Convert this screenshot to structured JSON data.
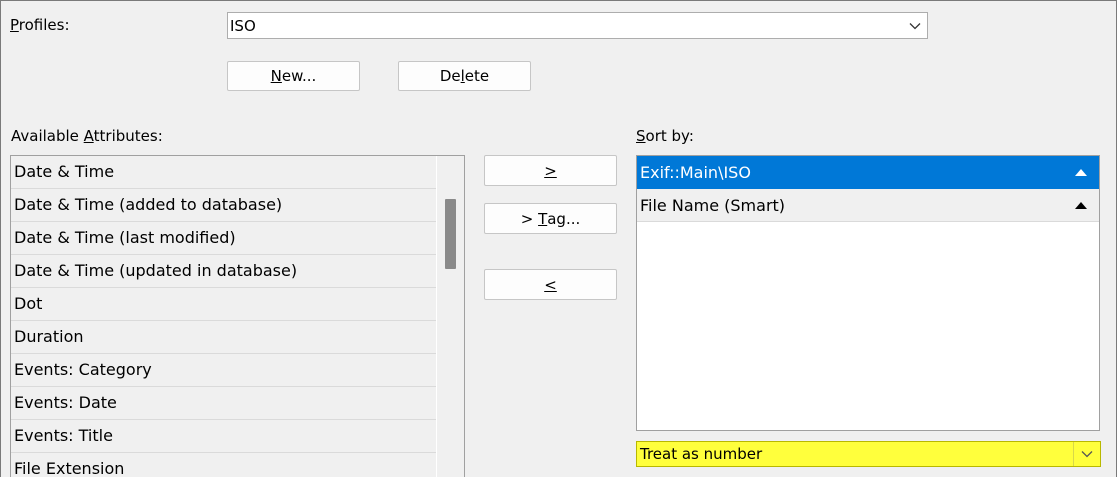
{
  "profiles": {
    "label_pre": "",
    "label_key": "P",
    "label_post": "rofiles:",
    "value": "ISO"
  },
  "buttons": {
    "new_pre": "",
    "new_key": "N",
    "new_post": "ew...",
    "delete_pre": "De",
    "delete_key": "l",
    "delete_post": "ete",
    "add_key": ">",
    "add_tag_pre": "> ",
    "add_tag_key": "T",
    "add_tag_post": "ag...",
    "remove_key": "<"
  },
  "available": {
    "label_pre": "Available ",
    "label_key": "A",
    "label_post": "ttributes:",
    "items": [
      "Date & Time",
      "Date & Time (added to database)",
      "Date & Time (last modified)",
      "Date & Time (updated in database)",
      "Dot",
      "Duration",
      "Events: Category",
      "Events: Date",
      "Events: Title",
      "File Extension"
    ]
  },
  "sort": {
    "label_key": "S",
    "label_post": "ort by:",
    "items": [
      {
        "label": "Exif::Main\\ISO",
        "direction": "ascending",
        "selected": true
      },
      {
        "label": "File Name (Smart)",
        "direction": "ascending",
        "selected": false
      }
    ],
    "mode_value": "Treat as number"
  },
  "colors": {
    "selection": "#0078d7",
    "highlight": "#ffff3c"
  }
}
